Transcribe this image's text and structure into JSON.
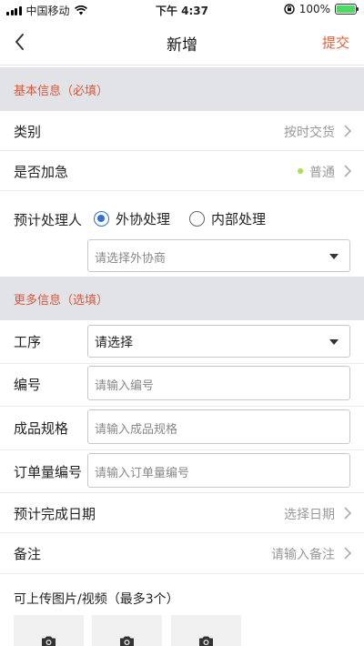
{
  "status_bar": {
    "carrier": "中国移动",
    "time": "下午 4:37",
    "battery": "100%",
    "battery_level": 1.0
  },
  "nav": {
    "title": "新增",
    "submit_label": "提交",
    "icons": {
      "back": "chevron-left-icon"
    }
  },
  "basic_section": {
    "title": "基本信息（必填）"
  },
  "category": {
    "label": "类别",
    "value": "按时交货"
  },
  "urgent": {
    "label": "是否加急",
    "value": "普通",
    "dot_color": "#a6e24a"
  },
  "handler": {
    "label": "预计处理人",
    "options": [
      {
        "label": "外协处理",
        "checked": true
      },
      {
        "label": "内部处理",
        "checked": false
      }
    ],
    "supplier_placeholder": "请选择外协商"
  },
  "more_section": {
    "title": "更多信息（选填）"
  },
  "process": {
    "label": "工序",
    "value": "请选择"
  },
  "number": {
    "label": "编号",
    "placeholder": "请输入编号"
  },
  "spec": {
    "label": "成品规格",
    "placeholder": "请输入成品规格"
  },
  "order_no": {
    "label": "订单量编号",
    "placeholder": "请输入订单量编号"
  },
  "due_date": {
    "label": "预计完成日期",
    "value": "选择日期"
  },
  "remark": {
    "label": "备注",
    "value": "请输入备注"
  },
  "upload": {
    "title": "可上传图片/视频（最多3个）",
    "slots": 3
  },
  "colors": {
    "accent": "#e0603a",
    "section_text": "#d9583a",
    "section_bg": "#e2e3e7",
    "radio_active": "#2f6fe0"
  }
}
